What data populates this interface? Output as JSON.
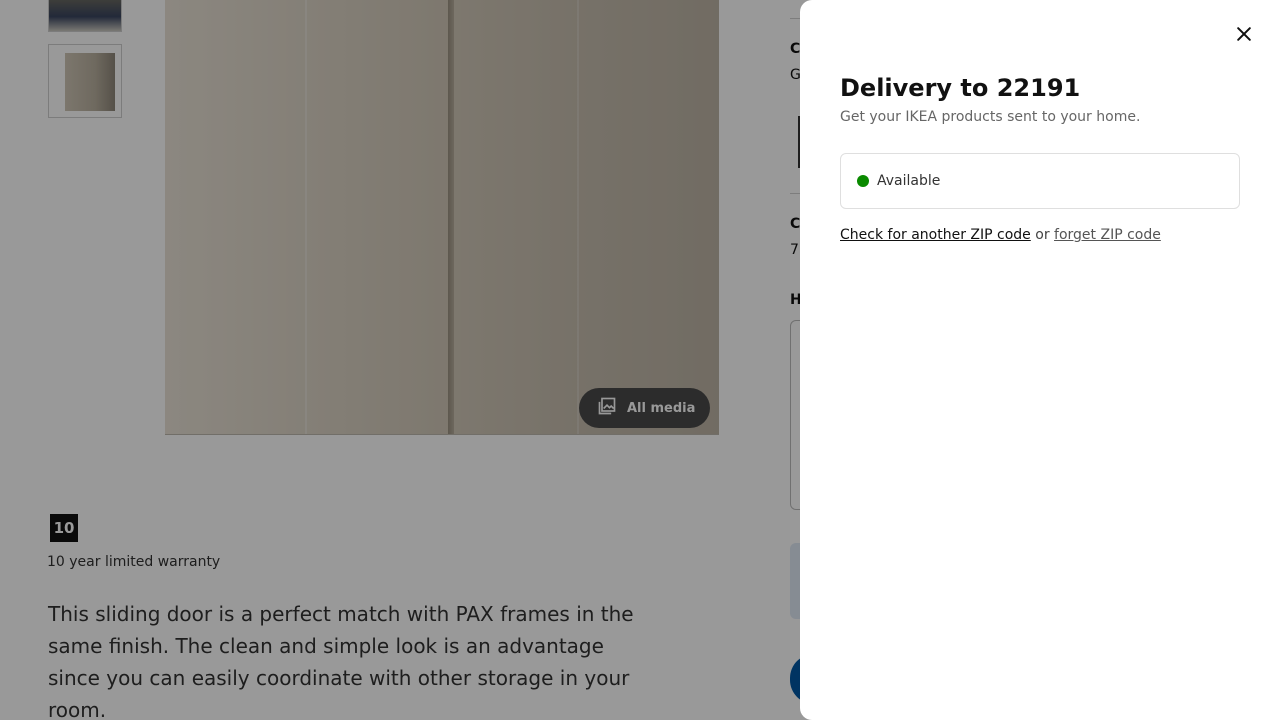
{
  "product_page": {
    "all_media_label": "All media",
    "warranty_years": "10",
    "warranty_text": "10 year limited warranty",
    "description": "This sliding door is a perfect match with PAX frames in the same finish. The clean and simple look is an advantage since you can easily coordinate with other storage in your room.",
    "right_column_fragments": [
      "C",
      "G",
      "C",
      "7",
      "H"
    ]
  },
  "delivery_sheet": {
    "title": "Delivery to 22191",
    "subtitle": "Get your IKEA products sent to your home.",
    "status_label": "Available",
    "status_color": "#0a8a00",
    "check_link": "Check for another ZIP code",
    "or_text": "or",
    "forget_link": "forget ZIP code"
  },
  "icons": {
    "close": "close-icon",
    "media": "image-gallery-icon"
  }
}
